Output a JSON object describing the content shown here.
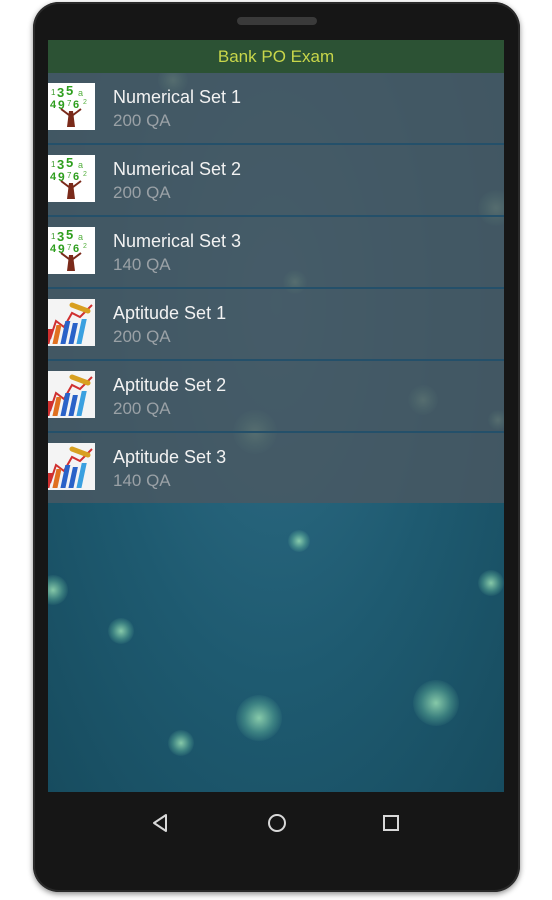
{
  "app": {
    "title": "Bank PO Exam"
  },
  "list": {
    "items": [
      {
        "title": "Numerical Set 1",
        "subtitle": "200 QA",
        "icon": "numbers-tree-icon"
      },
      {
        "title": "Numerical Set 2",
        "subtitle": "200 QA",
        "icon": "numbers-tree-icon"
      },
      {
        "title": "Numerical Set 3",
        "subtitle": "140 QA",
        "icon": "numbers-tree-icon"
      },
      {
        "title": "Aptitude Set 1",
        "subtitle": "200 QA",
        "icon": "bar-chart-icon"
      },
      {
        "title": "Aptitude Set 2",
        "subtitle": "200 QA",
        "icon": "bar-chart-icon"
      },
      {
        "title": "Aptitude Set 3",
        "subtitle": "140 QA",
        "icon": "bar-chart-icon"
      }
    ]
  },
  "navbar": {
    "back": "back-triangle-icon",
    "home": "home-circle-icon",
    "recents": "recents-square-icon"
  },
  "colors": {
    "title_bar_bg": "#2c5234",
    "title_text": "#c8d64a",
    "list_item_bg": "#4a5862",
    "screen_bg": "#1e5a70"
  }
}
